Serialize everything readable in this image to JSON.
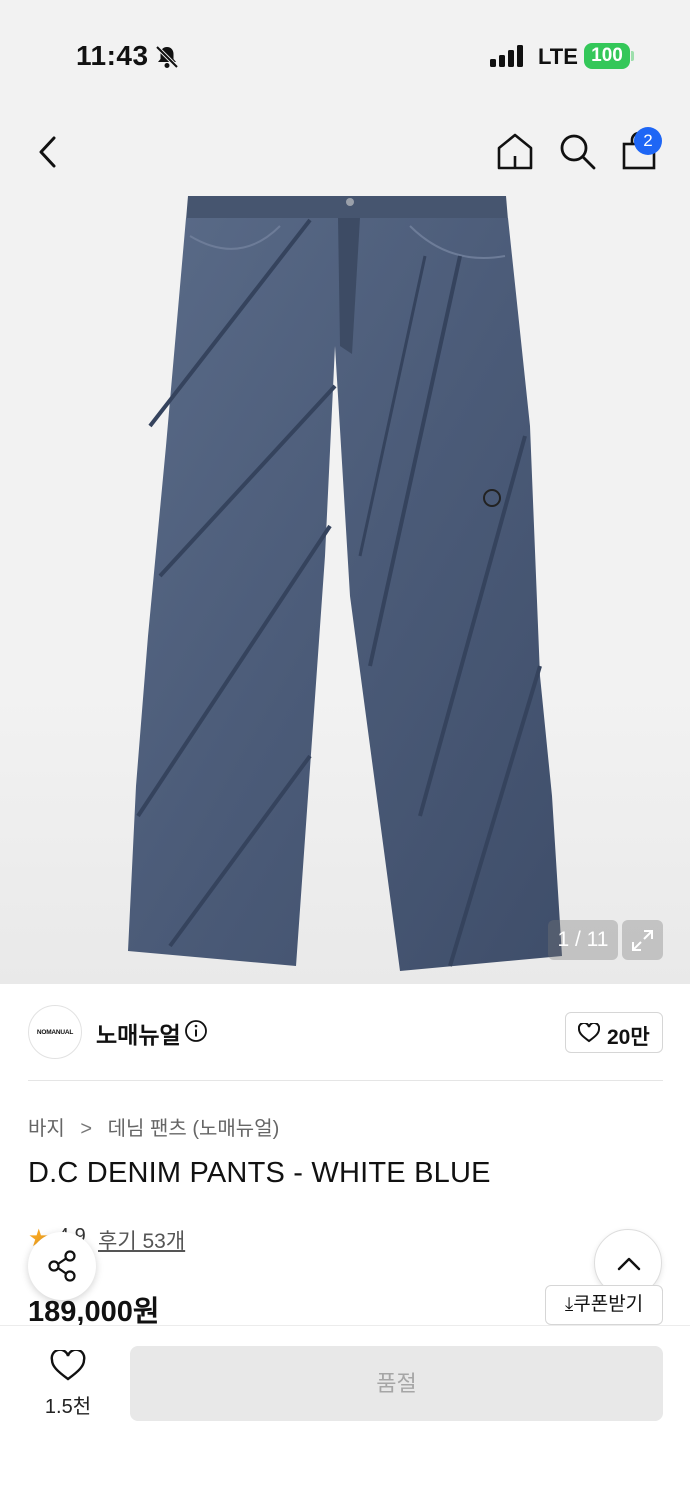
{
  "status_bar": {
    "time": "11:43",
    "network": "LTE",
    "battery": "100"
  },
  "nav": {
    "cart_count": "2"
  },
  "gallery": {
    "counter": "1 / 11"
  },
  "brand": {
    "logo_text": "NOMANUAL",
    "name": "노매뉴얼",
    "likes": "20만"
  },
  "breadcrumb": {
    "category": "바지",
    "separator": ">",
    "subcategory": "데님 팬츠 (노매뉴얼)"
  },
  "product": {
    "title": "D.C DENIM PANTS - WHITE BLUE",
    "rating_visible": "4.9",
    "reviews": "후기 53개",
    "price": "189,000원",
    "coupon_label": "쿠폰받기"
  },
  "bottom_bar": {
    "wish_count": "1.5천",
    "buy_label": "품절"
  },
  "colors": {
    "accent_blue": "#1e66f5",
    "battery_green": "#34c759",
    "star": "#f5a623",
    "denim": "#4a5a78"
  },
  "icons": [
    "bell-slash-icon",
    "signal-icon",
    "back-icon",
    "home-icon",
    "search-icon",
    "cart-icon",
    "expand-icon",
    "info-icon",
    "heart-icon",
    "share-icon",
    "chevron-up-icon",
    "download-icon",
    "star-icon"
  ]
}
